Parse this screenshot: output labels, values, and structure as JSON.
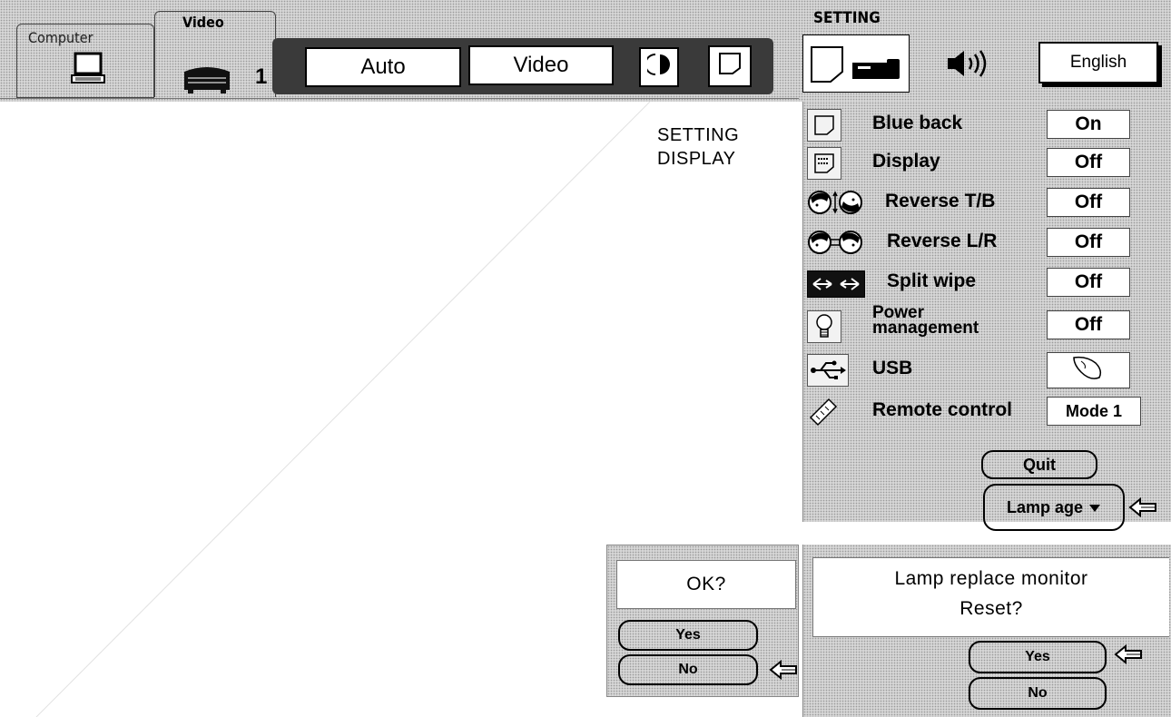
{
  "topbar": {
    "computer_tab_label": "Computer",
    "video_tab_label": "Video",
    "input_number": "1",
    "auto_button_label": "Auto",
    "video_button_label": "Video",
    "setting_label": "SETTING",
    "language_button_label": "English"
  },
  "side_label": {
    "line1": "SETTING",
    "line2": "DISPLAY"
  },
  "setting_menu": {
    "rows": [
      {
        "label": "Blue back",
        "value": "On"
      },
      {
        "label": "Display",
        "value": "Off"
      },
      {
        "label": "Reverse T/B",
        "value": "Off"
      },
      {
        "label": "Reverse L/R",
        "value": "Off"
      },
      {
        "label": "Split wipe",
        "value": "Off"
      },
      {
        "label_line1": "Power",
        "label_line2": "management",
        "value": "Off"
      },
      {
        "label": "USB",
        "value": ""
      },
      {
        "label": "Remote control",
        "value": "Mode 1"
      }
    ],
    "quit_label": "Quit",
    "lamp_age_label": "Lamp age"
  },
  "ok_dialog": {
    "message": "OK?",
    "yes_label": "Yes",
    "no_label": "No"
  },
  "lamp_dialog": {
    "message_line1": "Lamp replace monitor",
    "message_line2": "Reset?",
    "yes_label": "Yes",
    "no_label": "No"
  },
  "icons": {
    "computer": "laptop-icon",
    "video": "vcr-icon",
    "color": "contrast-icon",
    "screen": "screen-icon",
    "setting_screen": "screen-icon",
    "setting_projector": "projector-icon",
    "sound": "speaker-icon",
    "blue_back": "blue-back-icon",
    "display": "display-icon",
    "reverse_tb": "reverse-tb-icon",
    "reverse_lr": "reverse-lr-icon",
    "split_wipe": "split-wipe-icon",
    "power_management": "bulb-icon",
    "usb": "usb-icon",
    "remote_control": "remote-icon",
    "usb_value": "mouse-icon",
    "pointer": "left-arrow-icon"
  }
}
